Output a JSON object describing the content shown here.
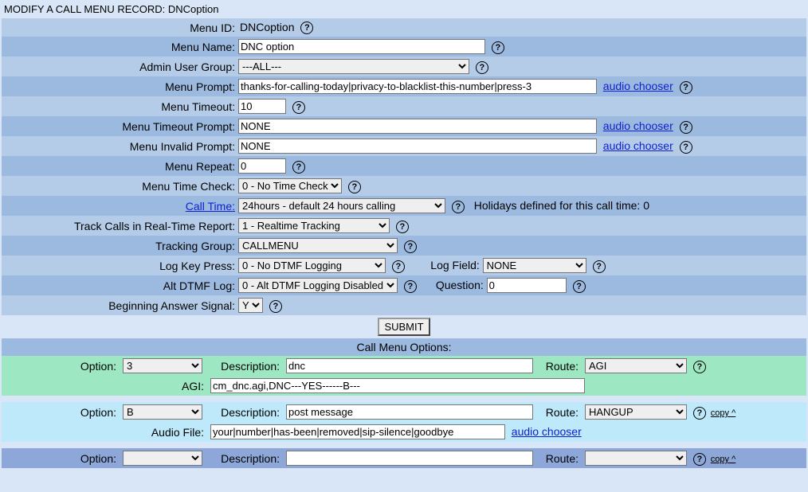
{
  "page_title": "MODIFY A CALL MENU RECORD: DNCoption",
  "labels": {
    "menu_id": "Menu ID:",
    "menu_name": "Menu Name:",
    "admin_user_group": "Admin User Group:",
    "menu_prompt": "Menu Prompt:",
    "menu_timeout": "Menu Timeout:",
    "menu_timeout_prompt": "Menu Timeout Prompt:",
    "menu_invalid_prompt": "Menu Invalid Prompt:",
    "menu_repeat": "Menu Repeat:",
    "menu_time_check": "Menu Time Check:",
    "call_time": "Call Time:",
    "track_calls": "Track Calls in Real-Time Report:",
    "tracking_group": "Tracking Group:",
    "log_key_press": "Log Key Press:",
    "log_field": "Log Field:",
    "alt_dtmf_log": "Alt DTMF Log:",
    "question": "Question:",
    "beginning_answer_signal": "Beginning Answer Signal:",
    "submit": "SUBMIT",
    "call_menu_options": "Call Menu Options:",
    "option": "Option:",
    "description": "Description:",
    "route": "Route:",
    "agi": "AGI:",
    "audio_file": "Audio File:"
  },
  "values": {
    "menu_id": "DNCoption",
    "menu_name": "DNC option",
    "admin_user_group": "---ALL---",
    "menu_prompt": "thanks-for-calling-today|privacy-to-blacklist-this-number|press-3",
    "menu_timeout": "10",
    "menu_timeout_prompt": "NONE",
    "menu_invalid_prompt": "NONE",
    "menu_repeat": "0",
    "menu_time_check": "0 - No Time Check",
    "call_time": "24hours - default 24 hours calling",
    "holidays_text": "Holidays defined for this call time: 0",
    "track_calls": "1 - Realtime Tracking",
    "tracking_group": "CALLMENU",
    "log_key_press": "0 - No DTMF Logging",
    "log_field": "NONE",
    "alt_dtmf_log": "0 - Alt DTMF Logging Disabled",
    "question": "0",
    "beginning_answer_signal": "Y"
  },
  "links": {
    "audio_chooser": "audio chooser",
    "copy": "copy ^"
  },
  "options": [
    {
      "option": "3",
      "description": "dnc",
      "route": "AGI",
      "extra_label": "AGI:",
      "extra_value": "cm_dnc.agi,DNC---YES------B---",
      "has_audio_chooser": false,
      "has_copy": false
    },
    {
      "option": "B",
      "description": "post message",
      "route": "HANGUP",
      "extra_label": "Audio File:",
      "extra_value": "your|number|has-been|removed|sip-silence|goodbye",
      "has_audio_chooser": true,
      "has_copy": true
    },
    {
      "option": "",
      "description": "",
      "route": "",
      "extra_label": "",
      "extra_value": "",
      "has_audio_chooser": false,
      "has_copy": true
    }
  ]
}
